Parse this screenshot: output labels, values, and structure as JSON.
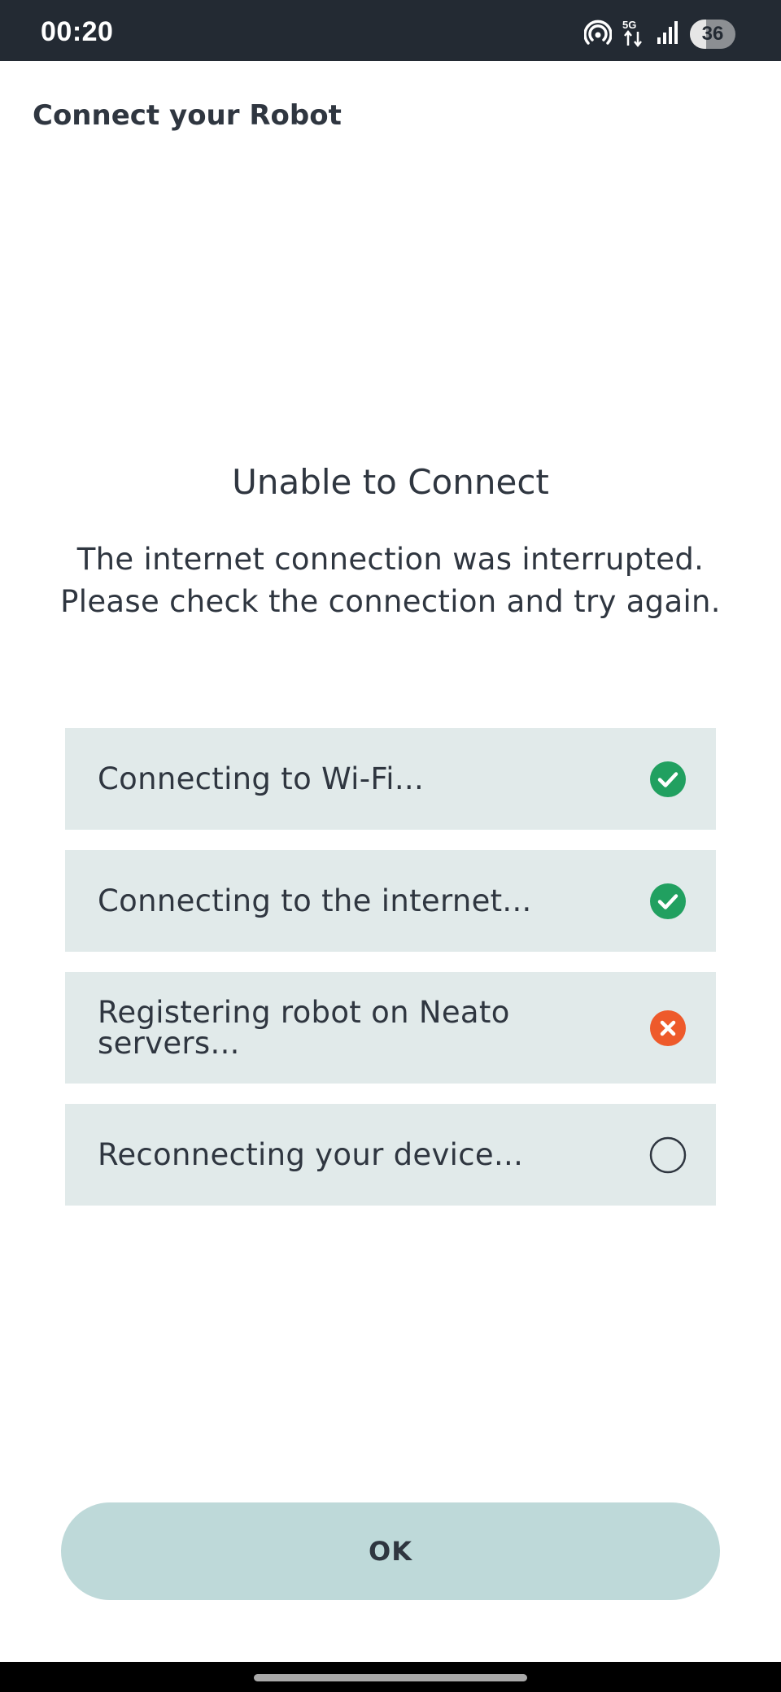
{
  "status_bar": {
    "time": "00:20",
    "icons": [
      "hotspot-icon",
      "5g-icon",
      "signal-icon",
      "battery-icon"
    ],
    "network_label": "5G",
    "battery_level": "36"
  },
  "header": {
    "title": "Connect your Robot"
  },
  "main": {
    "heading": "Unable to Connect",
    "message": "The internet connection was interrupted. Please check the connection and try again."
  },
  "steps": [
    {
      "label": "Connecting to Wi-Fi...",
      "status": "success",
      "icon": "check-circle-icon"
    },
    {
      "label": "Connecting to the internet...",
      "status": "success",
      "icon": "check-circle-icon"
    },
    {
      "label": "Registering robot on Neato servers...",
      "status": "error",
      "icon": "error-circle-icon"
    },
    {
      "label": "Reconnecting your device...",
      "status": "pending",
      "icon": "empty-circle-icon"
    }
  ],
  "footer": {
    "ok_label": "OK"
  },
  "colors": {
    "status_bar_bg": "#232a33",
    "step_bg": "#e1eaea",
    "success": "#21a060",
    "error": "#ee5a2b",
    "button_bg": "#bed9d9",
    "text": "#2f3640"
  }
}
